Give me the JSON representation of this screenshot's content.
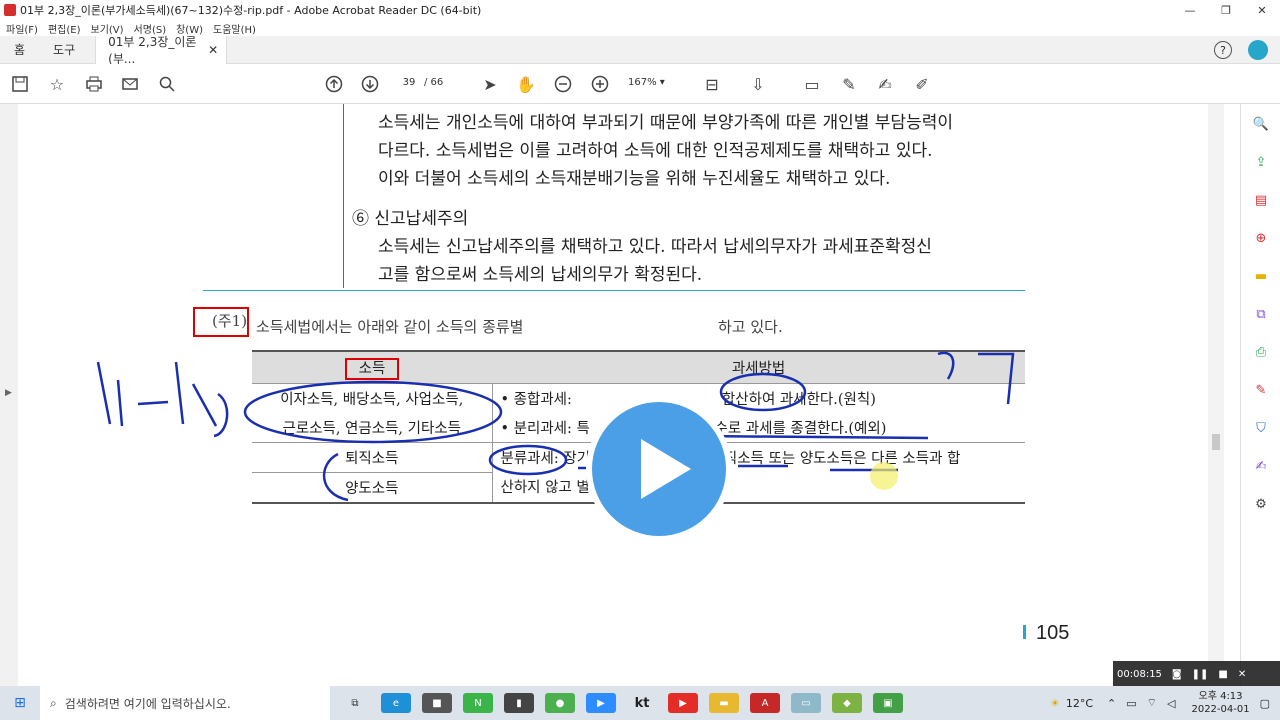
{
  "window": {
    "title": "01부 2,3장_이론(부가세소득세)(67~132)수정-rip.pdf - Adobe Acrobat Reader DC (64-bit)"
  },
  "menu": [
    "파일(F)",
    "편집(E)",
    "보기(V)",
    "서명(S)",
    "창(W)",
    "도움말(H)"
  ],
  "tabs": {
    "home": "홈",
    "tools": "도구",
    "doc": "01부 2,3장_이론(부..."
  },
  "toolbar": {
    "page_current": "39",
    "page_total": "/ 66",
    "zoom": "167%"
  },
  "document": {
    "para1": [
      "소득세는 개인소득에 대하여 부과되기 때문에 부양가족에 따른 개인별 부담능력이",
      "다르다. 소득세법은 이를 고려하여 소득에 대한 인적공제제도를 채택하고 있다.",
      "이와 더불어 소득세의 소득재분배기능을 위해 누진세율도 채택하고 있다."
    ],
    "item6_title": "⑥ 신고납세주의",
    "para2": [
      "소득세는 신고납세주의를 채택하고 있다. 따라서 납세의무자가 과세표준확정신",
      "고를 함으로써 소득세의 납세의무가 확정된다."
    ],
    "note_label": "(주1)",
    "note_text": "소득세법에서는 아래와 같이 소득의 종류별",
    "note_tail": "하고 있다.",
    "table_headers": [
      "소득",
      "과세방법"
    ],
    "rows": [
      {
        "income": "이자소득, 배당소득, 사업소득,",
        "method": "• 종합과세:",
        "method_tail": "합산하여 과세한다.(원칙)"
      },
      {
        "income": "근로소득, 연금소득, 기타소득",
        "method": "• 분리과세: 특",
        "method_tail": "대하여 원천징수로 과세를 종결한다.(예외)"
      },
      {
        "income": "퇴직소득",
        "method": "분류과세: 장기간에 걸쳐 발생하는 퇴직소득 또는 양도소득은 다른 소득과 합"
      },
      {
        "income": "양도소득",
        "method": "산하지 않고 별도로 과세한다."
      }
    ],
    "page_number": "105"
  },
  "recorder": {
    "time": "00:08:15"
  },
  "taskbar": {
    "search_placeholder": "검색하려면 여기에 입력하십시오.",
    "weather": "12°C",
    "time": "오후 4:13",
    "date": "2022-04-01"
  }
}
